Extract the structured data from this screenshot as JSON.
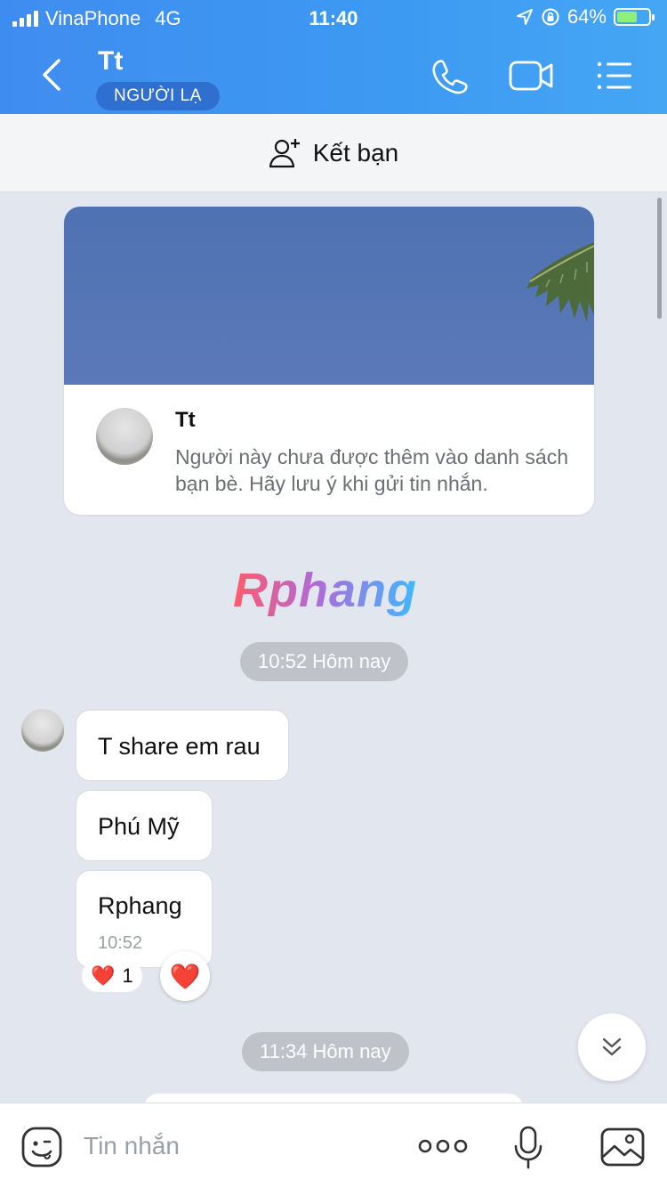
{
  "status": {
    "carrier": "VinaPhone",
    "network": "4G",
    "time": "11:40",
    "battery": "64%",
    "battery_level": 0.64
  },
  "header": {
    "title": "Tt",
    "badge": "NGƯỜI LẠ"
  },
  "add_friend": {
    "label": "Kết bạn"
  },
  "profile_card": {
    "name": "Tt",
    "description": "Người này chưa được thêm vào danh sách bạn bè. Hãy lưu ý khi gửi tin nhắn."
  },
  "watermark": "Rphang",
  "chat": {
    "separators": [
      "10:52 Hôm nay",
      "11:34 Hôm nay"
    ],
    "messages": [
      {
        "text": "T share em rau"
      },
      {
        "text": "Phú Mỹ"
      },
      {
        "text": "Rphang",
        "time": "10:52"
      }
    ],
    "reaction": {
      "emoji": "❤️",
      "count": "1"
    },
    "reaction_button_emoji": "❤️"
  },
  "composer": {
    "placeholder": "Tin nhắn"
  },
  "colors": {
    "header": "#3f8cf0",
    "background": "#e2e6ee",
    "badge": "#2f6fcf"
  }
}
